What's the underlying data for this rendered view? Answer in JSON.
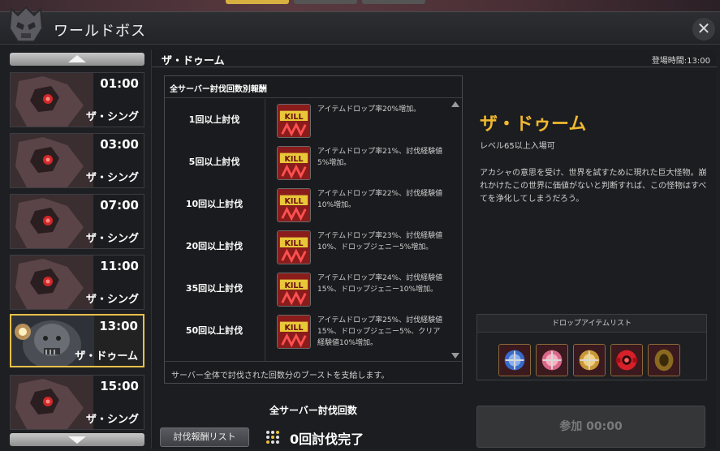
{
  "window": {
    "title": "ワールドボス",
    "close_label": "✕"
  },
  "bosses": [
    {
      "time": "01:00",
      "name": "ザ・シング",
      "selected": false
    },
    {
      "time": "03:00",
      "name": "ザ・シング",
      "selected": false
    },
    {
      "time": "07:00",
      "name": "ザ・シング",
      "selected": false
    },
    {
      "time": "11:00",
      "name": "ザ・シング",
      "selected": false
    },
    {
      "time": "13:00",
      "name": "ザ・ドゥーム",
      "selected": true
    },
    {
      "time": "15:00",
      "name": "ザ・シング",
      "selected": false
    }
  ],
  "main": {
    "title": "ザ・ドゥーム",
    "spawn_time": "登場時間:13:00"
  },
  "rewards": {
    "header": "全サーバー討伐回数別報酬",
    "rows": [
      {
        "condition": "1回以上討伐",
        "icon": "kill-icon",
        "desc": "アイテムドロップ率20%増加。"
      },
      {
        "condition": "5回以上討伐",
        "icon": "kill-icon",
        "desc": "アイテムドロップ率21%、討伐経験値5%増加。"
      },
      {
        "condition": "10回以上討伐",
        "icon": "kill-icon",
        "desc": "アイテムドロップ率22%、討伐経験値10%増加。"
      },
      {
        "condition": "20回以上討伐",
        "icon": "kill-icon",
        "desc": "アイテムドロップ率23%、討伐経験値10%、ドロップジェニー5%増加。"
      },
      {
        "condition": "35回以上討伐",
        "icon": "kill-icon",
        "desc": "アイテムドロップ率24%、討伐経験値15%、ドロップジェニー10%増加。"
      },
      {
        "condition": "50回以上討伐",
        "icon": "kill-icon",
        "desc": "アイテムドロップ率25%、討伐経験値15%、ドロップジェニー5%、クリア経験値10%増加。"
      }
    ],
    "footer": "サーバー全体で討伐された回数分のブーストを支給します。"
  },
  "total": {
    "label": "全サーバー討伐回数",
    "button_label": "討伐報酬リスト",
    "count_text": "0回討伐完了"
  },
  "boss_info": {
    "name": "ザ・ドゥーム",
    "level": "レベル65以上入場可",
    "description": "アカシャの意思を受け、世界を試すために現れた巨大怪物。崩れかけたこの世界に価値がないと判断すれば、この怪物はすべてを浄化してしまうだろう。"
  },
  "drops": {
    "header": "ドロップアイテムリスト",
    "items": [
      {
        "icon": "blue-orb-icon"
      },
      {
        "icon": "pink-orb-icon"
      },
      {
        "icon": "gold-orb-icon"
      },
      {
        "icon": "red-gear-icon"
      },
      {
        "icon": "bronze-disc-icon"
      }
    ]
  },
  "join": {
    "label": "参加 00:00"
  },
  "colors": {
    "accent": "#f0b830",
    "selected_border": "#e8c04a"
  }
}
